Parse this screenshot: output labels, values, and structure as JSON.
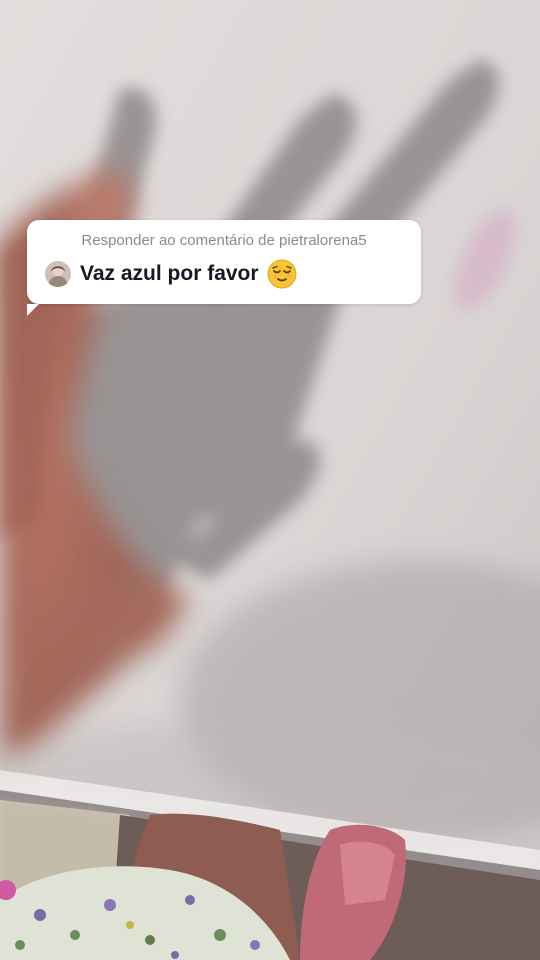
{
  "reply": {
    "header": "Responder ao comentário de pietralorena5",
    "comment": "Vaz azul por favor",
    "emoji": "relieved-face-emoji"
  },
  "colors": {
    "wall": "#dcd8d7",
    "shadow": "#8f8a8b",
    "hand": "#a8675a",
    "bubble": "#ffffff",
    "header_text": "#8a8b91",
    "comment_text": "#161823"
  }
}
